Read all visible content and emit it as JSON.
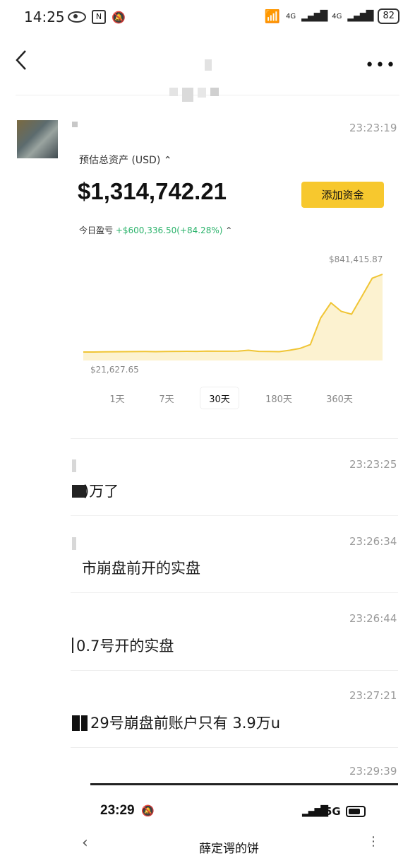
{
  "status_bar": {
    "time": "14:25",
    "network_1": "4G",
    "network_2": "4G",
    "battery": "82"
  },
  "messages": [
    {
      "timestamp": "23:23:19"
    },
    {
      "timestamp": "23:23:25",
      "text": ")万了"
    },
    {
      "timestamp": "23:26:34",
      "text": "市崩盘前开的实盘"
    },
    {
      "timestamp": "23:26:44",
      "text": "0.7号开的实盘"
    },
    {
      "timestamp": "23:27:21",
      "text": "29号崩盘前账户只有 3.9万u"
    },
    {
      "timestamp": "23:29:39"
    }
  ],
  "card": {
    "label": "预估总资产 (USD)",
    "balance": "$1,314,742.21",
    "add_funds": "添加资金",
    "pnl_label": "今日盈亏",
    "pnl_value": "+$600,336.50(+84.28%)",
    "ranges": [
      "1天",
      "7天",
      "30天",
      "180天",
      "360天"
    ],
    "active_range": "30天"
  },
  "chart_data": {
    "type": "area",
    "max_label": "$841,415.87",
    "min_label": "$21,627.65",
    "values": [
      21627.65,
      22000,
      23500,
      24800,
      25500,
      26000,
      26500,
      25000,
      27000,
      28000,
      29000,
      28500,
      31000,
      30000,
      29500,
      30500,
      40000,
      28000,
      27000,
      25000,
      40000,
      60000,
      100000,
      380000,
      540000,
      450000,
      420000,
      610000,
      800000,
      841415.87
    ],
    "color": "#f0c535",
    "fill": "#fbefc4"
  },
  "bottom_bar": {
    "time": "23:29",
    "network": "5G",
    "partial_title": "薛定谔的饼"
  }
}
